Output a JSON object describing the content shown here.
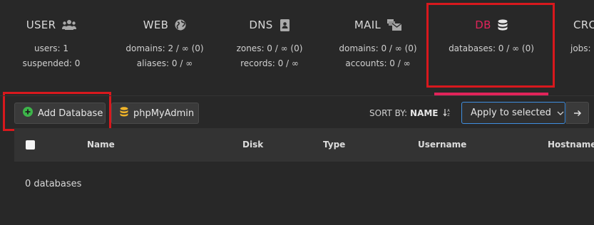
{
  "tabs": [
    {
      "label": "USER",
      "icon": "users-icon",
      "line1": "users: 1",
      "line2": "suspended: 0"
    },
    {
      "label": "WEB",
      "icon": "globe-icon",
      "line1": "domains: 2 / ∞ (0)",
      "line2": "aliases: 0 / ∞"
    },
    {
      "label": "DNS",
      "icon": "address-book-icon",
      "line1": "zones: 0 / ∞ (0)",
      "line2": "records: 0 / ∞"
    },
    {
      "label": "MAIL",
      "icon": "mail-bulk-icon",
      "line1": "domains: 0 / ∞ (0)",
      "line2": "accounts: 0 / ∞"
    },
    {
      "label": "DB",
      "icon": "database-icon",
      "line1": "databases: 0 / ∞ (0)",
      "line2": "",
      "active": true
    },
    {
      "label": "CRO",
      "icon": "",
      "line1": "jobs: 0",
      "line2": ""
    }
  ],
  "toolbar": {
    "add_label": "Add Database",
    "phpmyadmin_label": "phpMyAdmin",
    "sort_label": "SORT BY:",
    "sort_value": "NAME",
    "apply_label": "Apply to selected"
  },
  "table": {
    "columns": [
      "Name",
      "Disk",
      "Type",
      "Username",
      "Hostname"
    ]
  },
  "summary": {
    "count_text": "0 databases"
  },
  "colors": {
    "accent": "#e0245a",
    "highlight": "#d8181d",
    "add_icon": "#3db54a",
    "db_icon": "#f0b429",
    "select_border": "#3f8fe0"
  }
}
